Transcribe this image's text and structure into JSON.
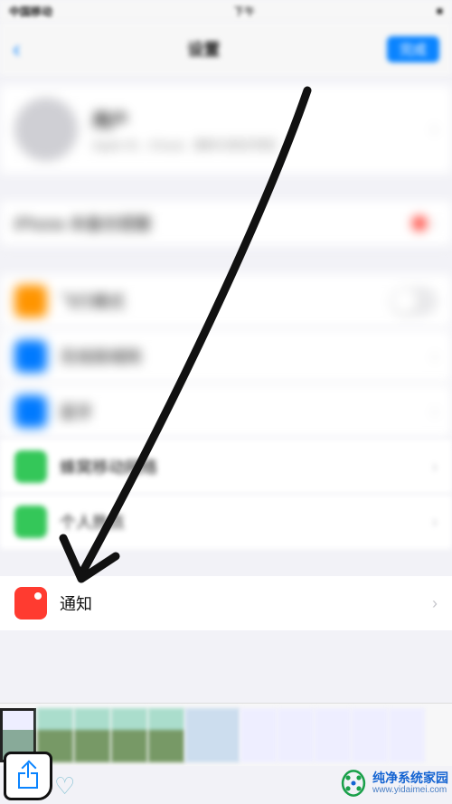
{
  "statusbar": {
    "carrier": "中国移动",
    "time": "下午",
    "battery": "■"
  },
  "navbar": {
    "title": "设置",
    "done": "完成"
  },
  "profile": {
    "name": "用户",
    "sub": "Apple ID、iCloud、媒体与购买项目"
  },
  "rows": {
    "alert_label": "iPhone 未备份提醒",
    "airplane": "飞行模式",
    "wifi": "无线局域网",
    "bluetooth": "蓝牙",
    "cellular": "蜂窝移动网络",
    "hotspot": "个人热点",
    "notifications": "通知"
  },
  "toolbar": {
    "heart": "♡"
  },
  "watermark": {
    "title": "纯净系统家园",
    "url": "www.yidaimei.com"
  }
}
